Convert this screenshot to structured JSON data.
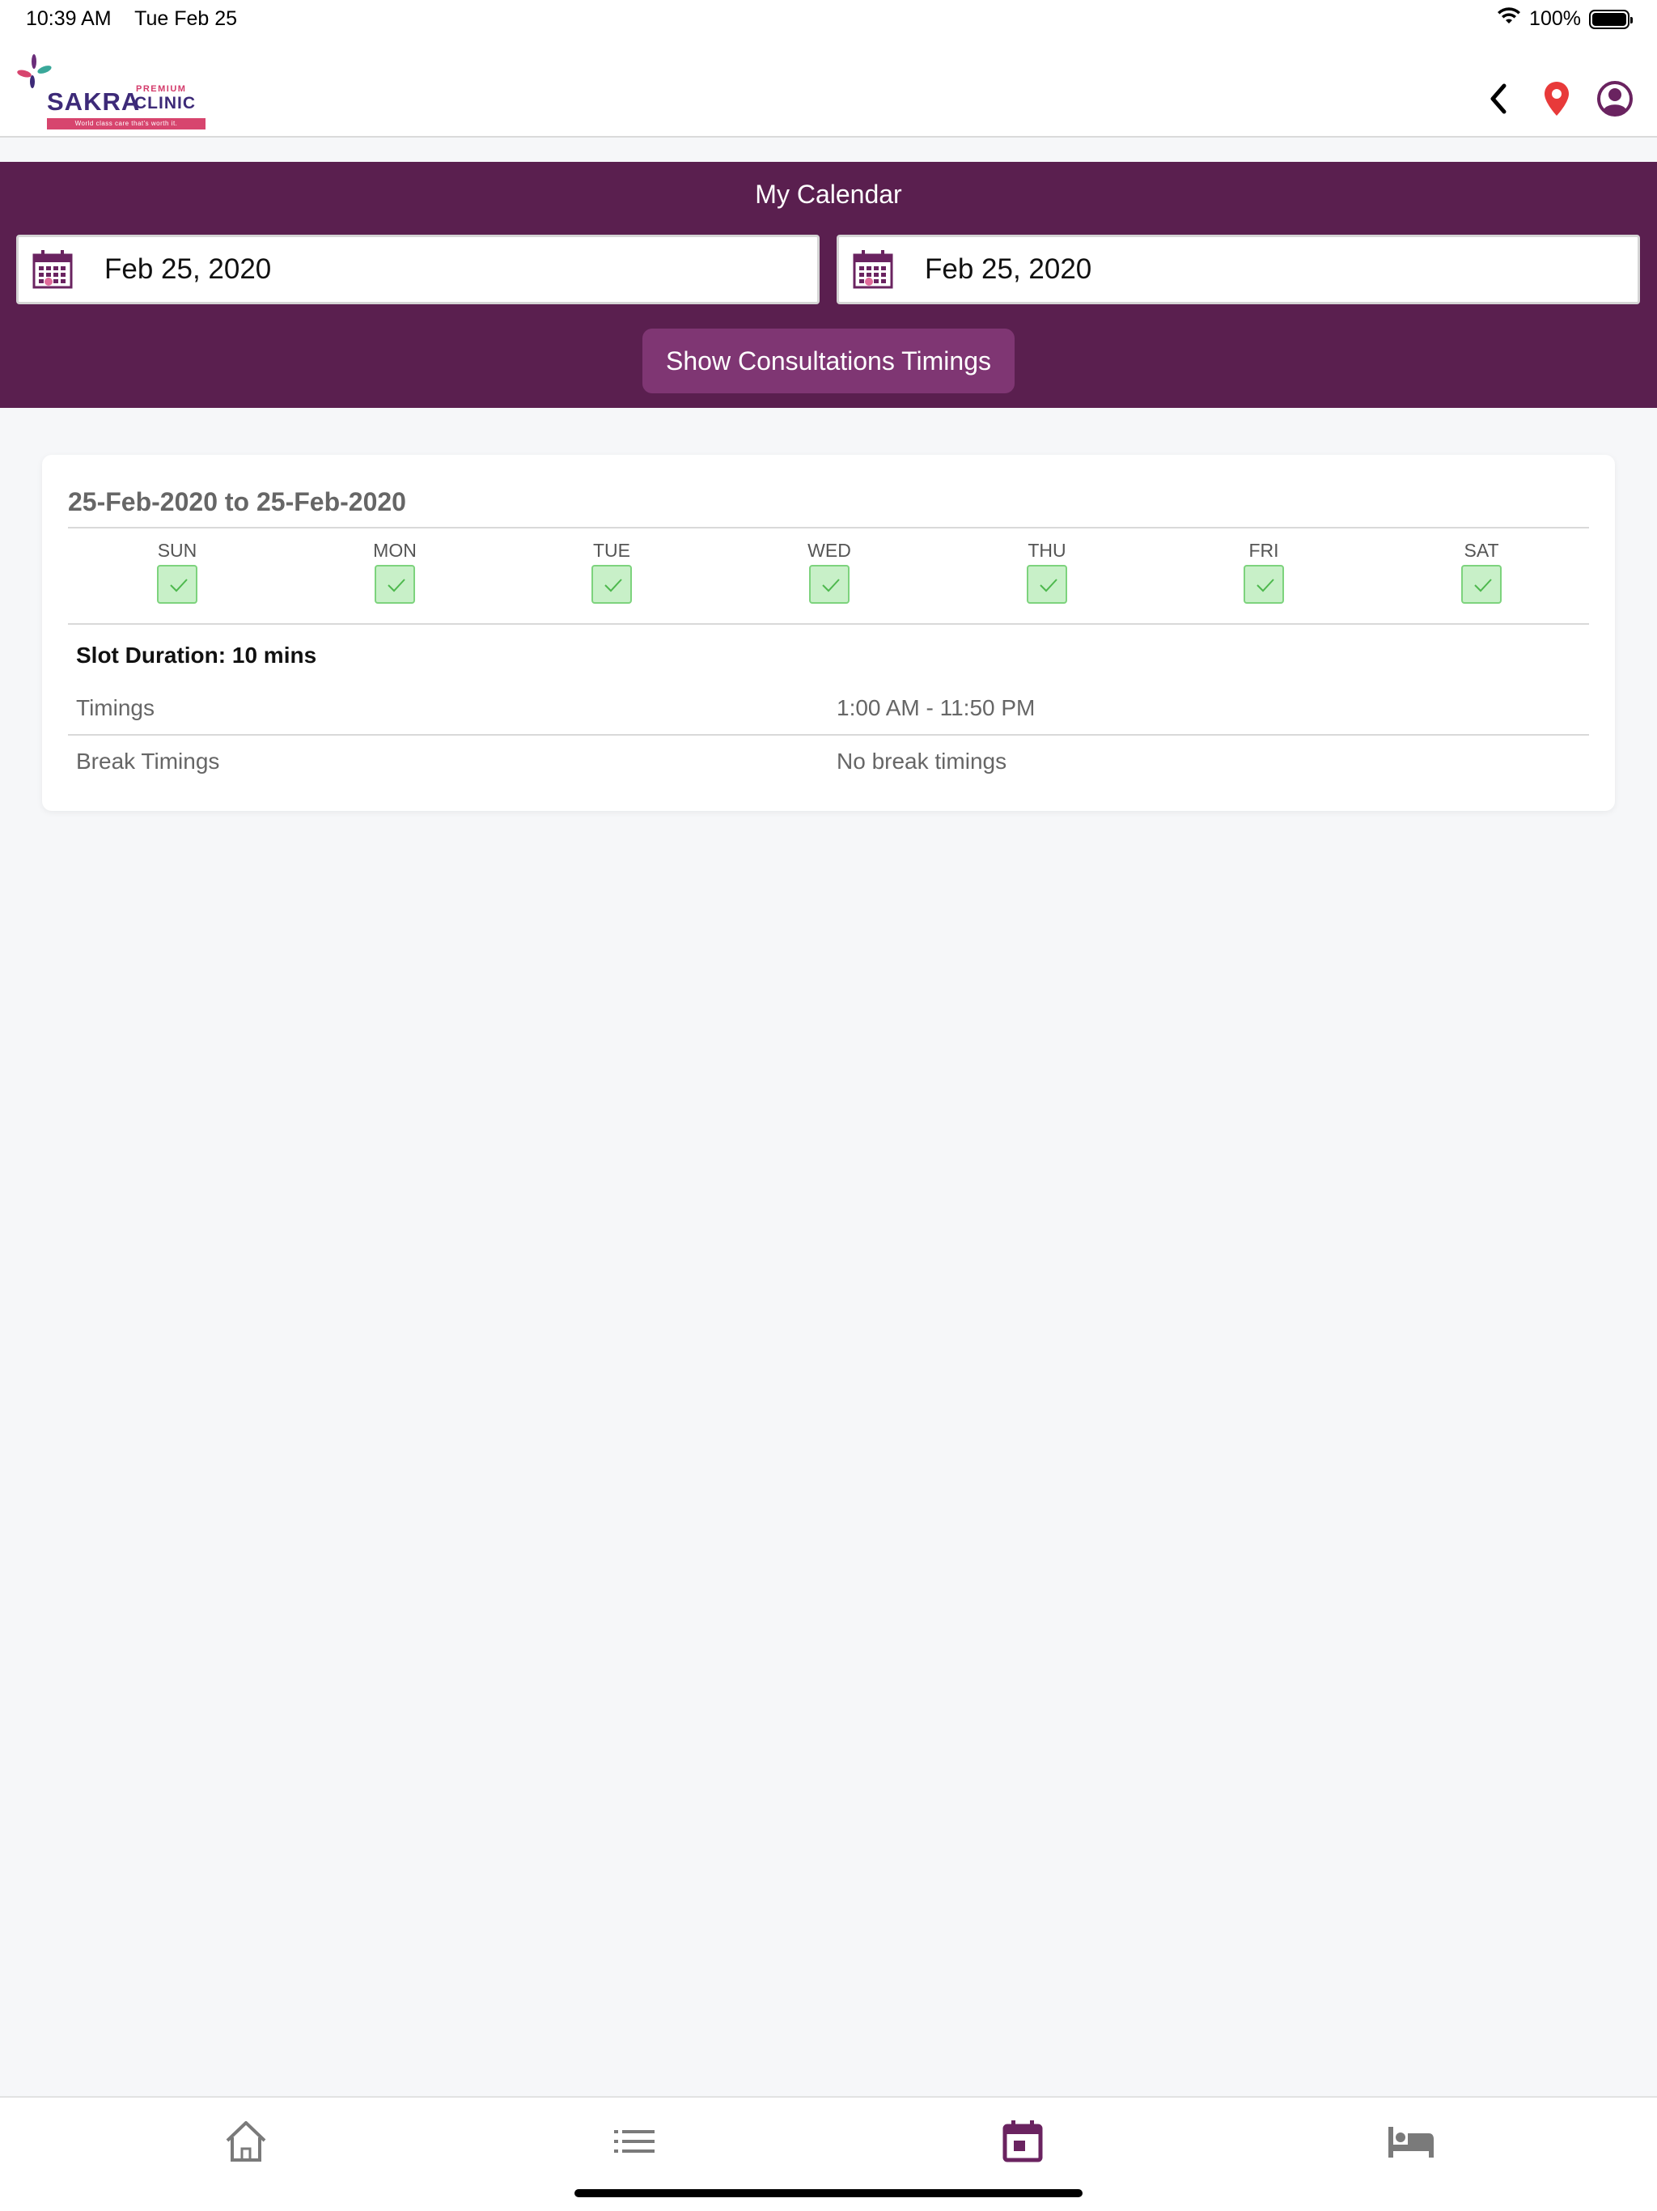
{
  "status_bar": {
    "time": "10:39 AM",
    "date": "Tue Feb 25",
    "battery": "100%"
  },
  "header": {
    "logo": {
      "brand": "SAKRA",
      "premium": "PREMIUM",
      "clinic": "CLINIC",
      "tagline": "World class care that's worth it."
    },
    "icons": [
      "back-icon",
      "location-pin-icon",
      "profile-icon"
    ],
    "colors": {
      "pin": "#e83a3a",
      "profile": "#6a2360"
    }
  },
  "calendar": {
    "title": "My Calendar",
    "from_date": "Feb 25, 2020",
    "to_date": "Feb 25, 2020",
    "button_label": "Show Consultations Timings",
    "colors": {
      "panel": "#5a1f4f",
      "button": "#7f3673"
    }
  },
  "schedule": {
    "range": "25-Feb-2020 to 25-Feb-2020",
    "days": [
      {
        "label": "SUN",
        "checked": true
      },
      {
        "label": "MON",
        "checked": true
      },
      {
        "label": "TUE",
        "checked": true
      },
      {
        "label": "WED",
        "checked": true
      },
      {
        "label": "THU",
        "checked": true
      },
      {
        "label": "FRI",
        "checked": true
      },
      {
        "label": "SAT",
        "checked": true
      }
    ],
    "slot_duration": "Slot Duration: 10 mins",
    "rows": [
      {
        "label": "Timings",
        "value": "1:00 AM - 11:50 PM"
      },
      {
        "label": "Break Timings",
        "value": "No break timings"
      }
    ]
  },
  "bottom_nav": {
    "items": [
      {
        "icon": "home-icon",
        "active": false
      },
      {
        "icon": "list-icon",
        "active": false
      },
      {
        "icon": "calendar-icon",
        "active": true
      },
      {
        "icon": "bed-icon",
        "active": false
      }
    ],
    "colors": {
      "active": "#6a2360",
      "inactive": "#7a7a7a"
    }
  }
}
